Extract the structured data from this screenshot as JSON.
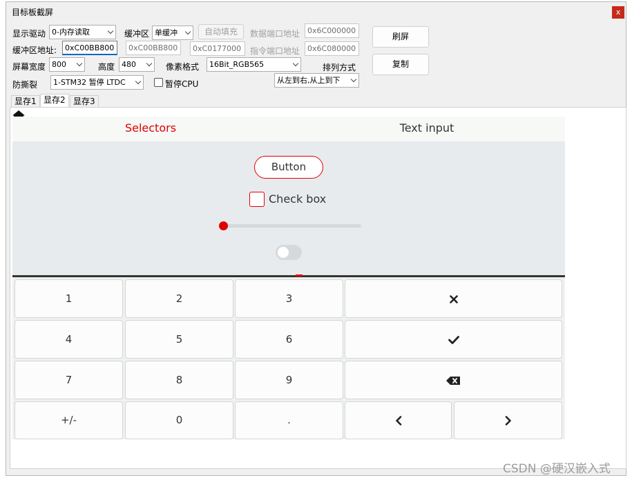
{
  "window": {
    "title": "目标板截屏",
    "close_label": "x"
  },
  "controls": {
    "display_driver_label": "显示驱动",
    "display_driver_value": "0-内存读取",
    "buffer_label": "缓冲区",
    "buffer_value": "单缓冲",
    "autofill_button": "自动填充",
    "data_port_label": "数据端口地址",
    "data_port_value": "0x6C000000",
    "refresh_button": "刷屏",
    "buffer_addr_label": "缓冲区地址:",
    "buffer_addr_value": "0xC00BB800",
    "buffer_addr2_value": "0xC00BB800",
    "buffer_addr3_value": "0xC0177000",
    "cmd_port_label": "指令端口地址",
    "cmd_port_value": "0x6C080000",
    "copy_button": "复制",
    "screen_width_label": "屏幕宽度",
    "screen_width_value": "800",
    "height_label": "高度",
    "height_value": "480",
    "pixel_format_label": "像素格式",
    "pixel_format_value": "16Bit_RGB565",
    "arrangement_label": "排列方式",
    "anti_tear_label": "防撕裂",
    "anti_tear_value": "1-STM32 暂停 LTDC",
    "pause_cpu_label": "暂停CPU",
    "arrangement_value": "从左到右,从上到下"
  },
  "tabs": [
    {
      "label": "显存1"
    },
    {
      "label": "显存2"
    },
    {
      "label": "显存3"
    }
  ],
  "lvgl": {
    "tab_selectors": "Selectors",
    "tab_text_input": "Text input",
    "button_label": "Button",
    "checkbox_label": "Check box",
    "slider_value": 0,
    "switch_on": false,
    "keys": {
      "k1": "1",
      "k2": "2",
      "k3": "3",
      "k4": "4",
      "k5": "5",
      "k6": "6",
      "k7": "7",
      "k8": "8",
      "k9": "9",
      "kpm": "+/-",
      "k0": "0",
      "kdot": "."
    },
    "accent_color": "#e00000"
  },
  "watermark": "CSDN @硬汉嵌入式"
}
